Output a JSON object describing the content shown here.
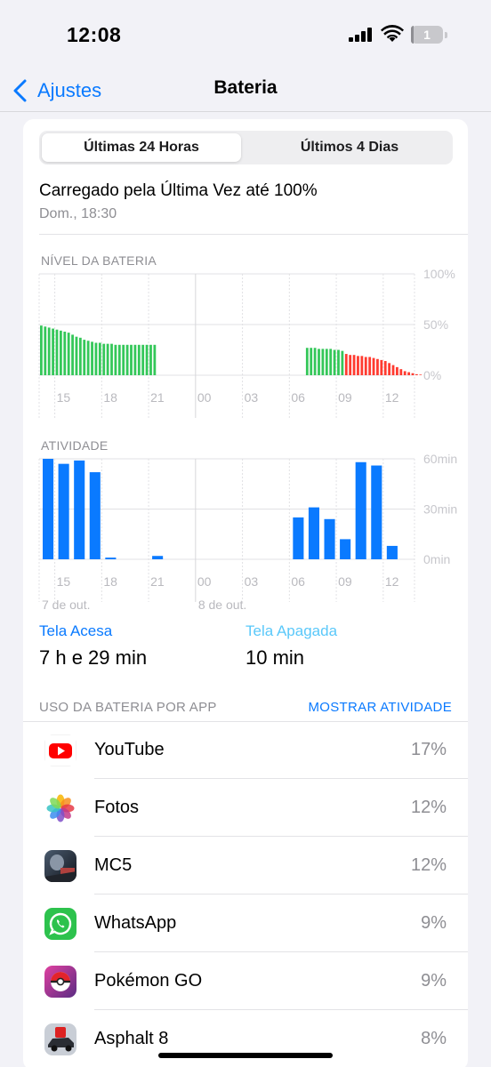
{
  "status": {
    "time": "12:08",
    "battery_level": "1"
  },
  "nav": {
    "back_label": "Ajustes",
    "title": "Bateria"
  },
  "segments": [
    {
      "label": "Últimas 24 Horas",
      "active": true
    },
    {
      "label": "Últimos 4 Dias",
      "active": false
    }
  ],
  "last_charge": {
    "title": "Carregado pela Última Vez até 100%",
    "time": "Dom., 18:30"
  },
  "battery_level_chart": {
    "label": "NÍVEL DA BATERIA",
    "y_ticks": [
      "100%",
      "50%",
      "0%"
    ],
    "x_ticks": [
      "15",
      "18",
      "21",
      "00",
      "03",
      "06",
      "09",
      "12"
    ]
  },
  "activity_chart": {
    "label": "ATIVIDADE",
    "y_ticks": [
      "60min",
      "30min",
      "0min"
    ],
    "x_ticks": [
      "15",
      "18",
      "21",
      "00",
      "03",
      "06",
      "09",
      "12"
    ],
    "date_labels": [
      "7 de out.",
      "8 de out."
    ]
  },
  "chart_data": [
    {
      "type": "bar",
      "title": "NÍVEL DA BATERIA",
      "x_start_hour": 14,
      "bar_step_hours": 0.25,
      "ylim": [
        0,
        100
      ],
      "series": [
        {
          "color": "#34c759",
          "start_index": 0,
          "values": [
            49,
            48,
            47,
            46,
            45,
            44,
            43,
            42,
            40,
            38,
            37,
            35,
            34,
            33,
            32,
            32,
            31,
            31,
            31,
            30,
            30,
            30,
            30,
            30,
            30,
            30,
            30,
            30,
            30,
            30
          ]
        },
        {
          "color": "#34c759",
          "start_index": 68,
          "values": [
            27,
            27,
            27,
            26,
            26,
            26,
            26,
            25,
            25,
            24
          ]
        },
        {
          "color": "#ff3b30",
          "start_index": 78,
          "values": [
            21,
            20,
            20,
            19,
            19,
            18,
            18,
            17,
            16,
            15,
            14,
            12,
            10,
            8,
            6,
            4,
            3,
            2,
            1,
            0.6
          ]
        }
      ]
    },
    {
      "type": "bar",
      "title": "ATIVIDADE",
      "x_start_hour": 14,
      "bar_step_hours": 1,
      "ylim": [
        0,
        60
      ],
      "unit": "min",
      "series": [
        {
          "color": "#0a7aff",
          "values": [
            60,
            57,
            59,
            52,
            1,
            0,
            0,
            2,
            0,
            0,
            0,
            0,
            0,
            0,
            0,
            0,
            25,
            31,
            24,
            12,
            58,
            56,
            8
          ]
        }
      ]
    }
  ],
  "screen_time": {
    "on_label": "Tela Acesa",
    "on_value": "7 h e 29 min",
    "off_label": "Tela Apagada",
    "off_value": "10 min"
  },
  "usage": {
    "header": "USO DA BATERIA POR APP",
    "show_activity": "MOSTRAR ATIVIDADE",
    "apps": [
      {
        "name": "YouTube",
        "percent": "17%",
        "icon": "youtube-icon"
      },
      {
        "name": "Fotos",
        "percent": "12%",
        "icon": "photos-icon"
      },
      {
        "name": "MC5",
        "percent": "12%",
        "icon": "mc5-icon"
      },
      {
        "name": "WhatsApp",
        "percent": "9%",
        "icon": "whatsapp-icon"
      },
      {
        "name": "Pokémon GO",
        "percent": "9%",
        "icon": "pokemon-go-icon"
      },
      {
        "name": "Asphalt 8",
        "percent": "8%",
        "icon": "asphalt-8-icon"
      }
    ]
  },
  "colors": {
    "accent": "#0a7aff",
    "battery_green": "#34c759",
    "battery_red": "#ff3b30",
    "activity_blue": "#0a7aff",
    "screen_off": "#5ac8fa"
  }
}
